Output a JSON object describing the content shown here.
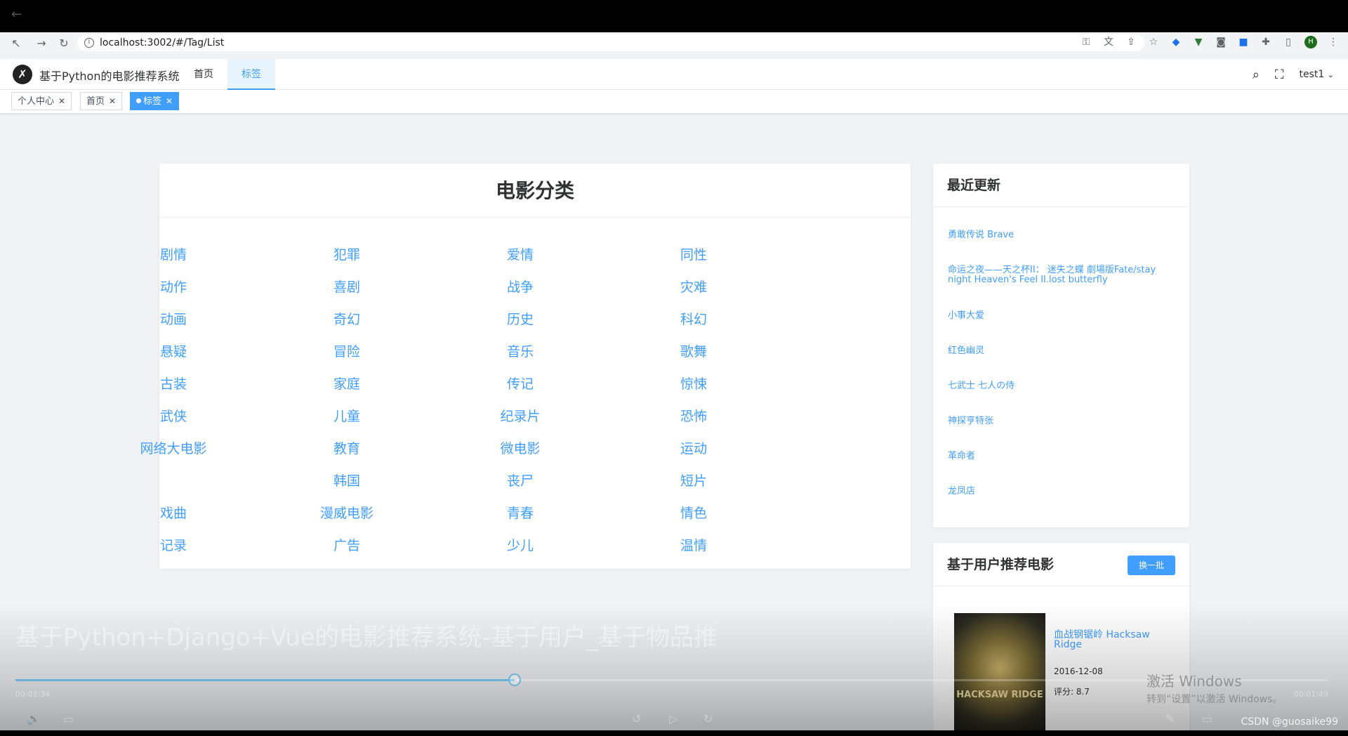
{
  "browser": {
    "url": "localhost:3002/#/Tag/List"
  },
  "header": {
    "app_title": "基于Python的电影推荐系统",
    "menu": [
      "首页",
      "标签"
    ],
    "active_menu_index": 1,
    "user": "test1"
  },
  "tags": [
    "个人中心",
    "首页",
    "标签"
  ],
  "categories": {
    "title": "电影分类",
    "rows": [
      [
        "剧情",
        "犯罪",
        "爱情",
        "同性"
      ],
      [
        "动作",
        "喜剧",
        "战争",
        "灾难"
      ],
      [
        "动画",
        "奇幻",
        "历史",
        "科幻"
      ],
      [
        "悬疑",
        "冒险",
        "音乐",
        "歌舞"
      ],
      [
        "古装",
        "家庭",
        "传记",
        "惊悚"
      ],
      [
        "武侠",
        "儿童",
        "纪录片",
        "恐怖"
      ],
      [
        "网络大电影",
        "教育",
        "微电影",
        "运动"
      ],
      [
        "",
        "韩国",
        "丧尸",
        "短片"
      ],
      [
        "戏曲",
        "漫威电影",
        "青春",
        "情色"
      ],
      [
        "记录",
        "广告",
        "少儿",
        "温情"
      ]
    ]
  },
  "recent": {
    "title": "最近更新",
    "items": [
      "勇敢传说 Brave",
      "命运之夜——天之杯II： 迷失之蝶 劇場版Fate/stay night Heaven's Feel II.lost butterfly",
      "小事大爱",
      "红色幽灵",
      "七武士 七人の侍",
      "神探亨特张",
      "革命者",
      "龙凤店"
    ]
  },
  "recommend": {
    "title": "基于用户推荐电影",
    "button": "换一批",
    "movie": {
      "title": "血战钢锯岭 Hacksaw Ridge",
      "date": "2016-12-08",
      "score": "评分: 8.7",
      "poster_text": "HACKSAW RIDGE"
    }
  },
  "video": {
    "title": "基于Python+Django+Vue的电影推荐系统-基于用户_基于物品推",
    "time_current": "00:01:34",
    "time_total": "00:01:49",
    "progress": 0.38
  },
  "overlay": {
    "windows_line1": "激活 Windows",
    "windows_line2": "转到“设置”以激活 Windows。",
    "watermark": "CSDN @guosaike99"
  }
}
